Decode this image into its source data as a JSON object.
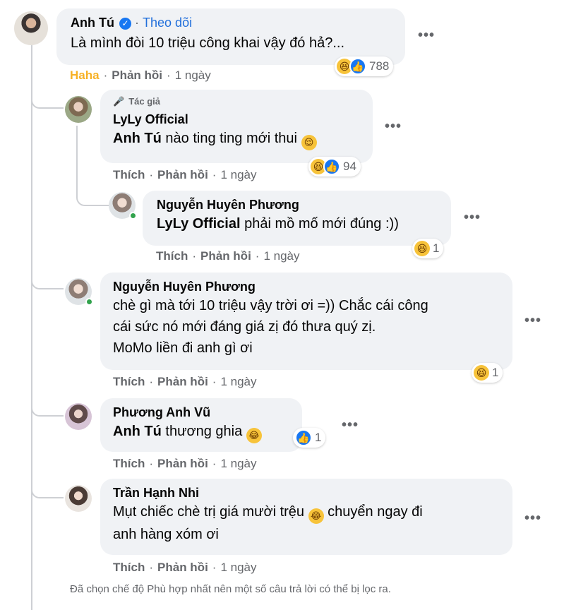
{
  "comments": [
    {
      "name": "Anh Tú",
      "follow": "Theo dõi",
      "text": "Là mình đòi 10 triệu công khai vậy đó hả?...",
      "reaction_label": "Haha",
      "reply": "Phản hồi",
      "time": "1 ngày",
      "reaction_count": "788"
    },
    {
      "author_badge": "Tác giả",
      "name": "LyLy Official",
      "mention": "Anh Tú",
      "text": " nào ting ting mới thui ",
      "like": "Thích",
      "reply": "Phản hồi",
      "time": "1 ngày",
      "reaction_count": "94"
    },
    {
      "name": "Nguyễn Huyên Phương",
      "mention": "LyLy Official",
      "text": " phải mồ mố mới đúng :))",
      "like": "Thích",
      "reply": "Phản hồi",
      "time": "1 ngày",
      "reaction_count": "1"
    },
    {
      "name": "Nguyễn Huyên Phương",
      "line1": "chè gì mà tới 10 triệu vậy trời ơi =)) Chắc cái công",
      "line2": "cái sức nó mới đáng giá zị đó thưa quý zị.",
      "line3": "MoMo liền đi anh gì ơi",
      "like": "Thích",
      "reply": "Phản hồi",
      "time": "1 ngày",
      "reaction_count": "1"
    },
    {
      "name": "Phương Anh Vũ",
      "mention": "Anh Tú",
      "text": " thương ghia ",
      "like": "Thích",
      "reply": "Phản hồi",
      "time": "1 ngày",
      "reaction_count": "1"
    },
    {
      "name": "Trần Hạnh Nhi",
      "line1a": "Mụt chiếc chè trị giá mười trệu ",
      "line1b": " chuyển ngay đi",
      "line2": "anh hàng xóm ơi",
      "like": "Thích",
      "reply": "Phản hồi",
      "time": "1 ngày"
    }
  ],
  "separator": "·",
  "more_icon": "•••",
  "footer": "Đã chọn chế độ Phù hợp nhất nên một số câu trả lời có thể bị lọc ra.",
  "colors": {
    "bubble": "#f0f2f5",
    "link": "#216fdb",
    "haha": "#f7b125",
    "secondary": "#65676b",
    "like": "#1877f2"
  }
}
